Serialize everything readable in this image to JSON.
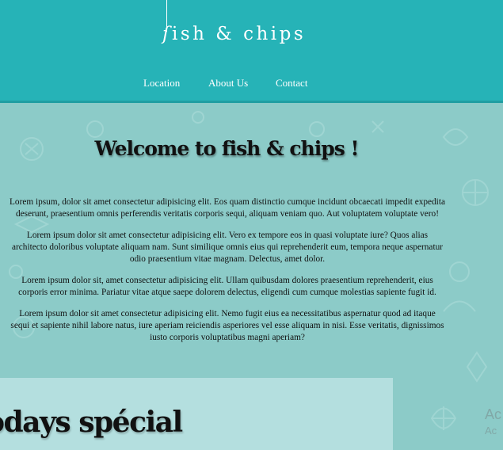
{
  "header": {
    "logo_initial": "ſ",
    "logo_rest": "ish & chips",
    "bg_color": "#26b3b7",
    "nav": [
      {
        "label": "Location"
      },
      {
        "label": "About Us"
      },
      {
        "label": "Contact"
      }
    ]
  },
  "main": {
    "bg_color": "#8ccbc8",
    "title": "Welcome to fish & chips !",
    "paragraphs": [
      "Lorem ipsum, dolor sit amet consectetur adipisicing elit. Eos quam distinctio cumque incidunt obcaecati impedit expedita deserunt, praesentium omnis perferendis veritatis corporis sequi, aliquam veniam quo. Aut voluptatem voluptate vero!",
      "Lorem ipsum dolor sit amet consectetur adipisicing elit. Vero ex tempore eos in quasi voluptate iure? Quos alias architecto doloribus voluptate aliquam nam. Sunt similique omnis eius qui reprehenderit eum, tempora neque aspernatur odio praesentium vitae magnam. Delectus, amet dolor.",
      "Lorem ipsum dolor sit, amet consectetur adipisicing elit. Ullam quibusdam dolores praesentium reprehenderit, eius corporis error minima. Pariatur vitae atque saepe dolorem delectus, eligendi cum cumque molestias sapiente fugit id.",
      "Lorem ipsum dolor sit amet consectetur adipisicing elit. Nemo fugit eius ea necessitatibus aspernatur quod ad itaque sequi et sapiente nihil labore natus, iure aperiam reiciendis asperiores vel esse aliquam in nisi. Esse veritatis, dignissimos iusto corporis voluptatibus magni aperiam?"
    ],
    "special_title": "odays spécial",
    "special_bg": "#b4dfdf"
  },
  "overlay": {
    "line1": "Ac",
    "line2": "Ac"
  }
}
